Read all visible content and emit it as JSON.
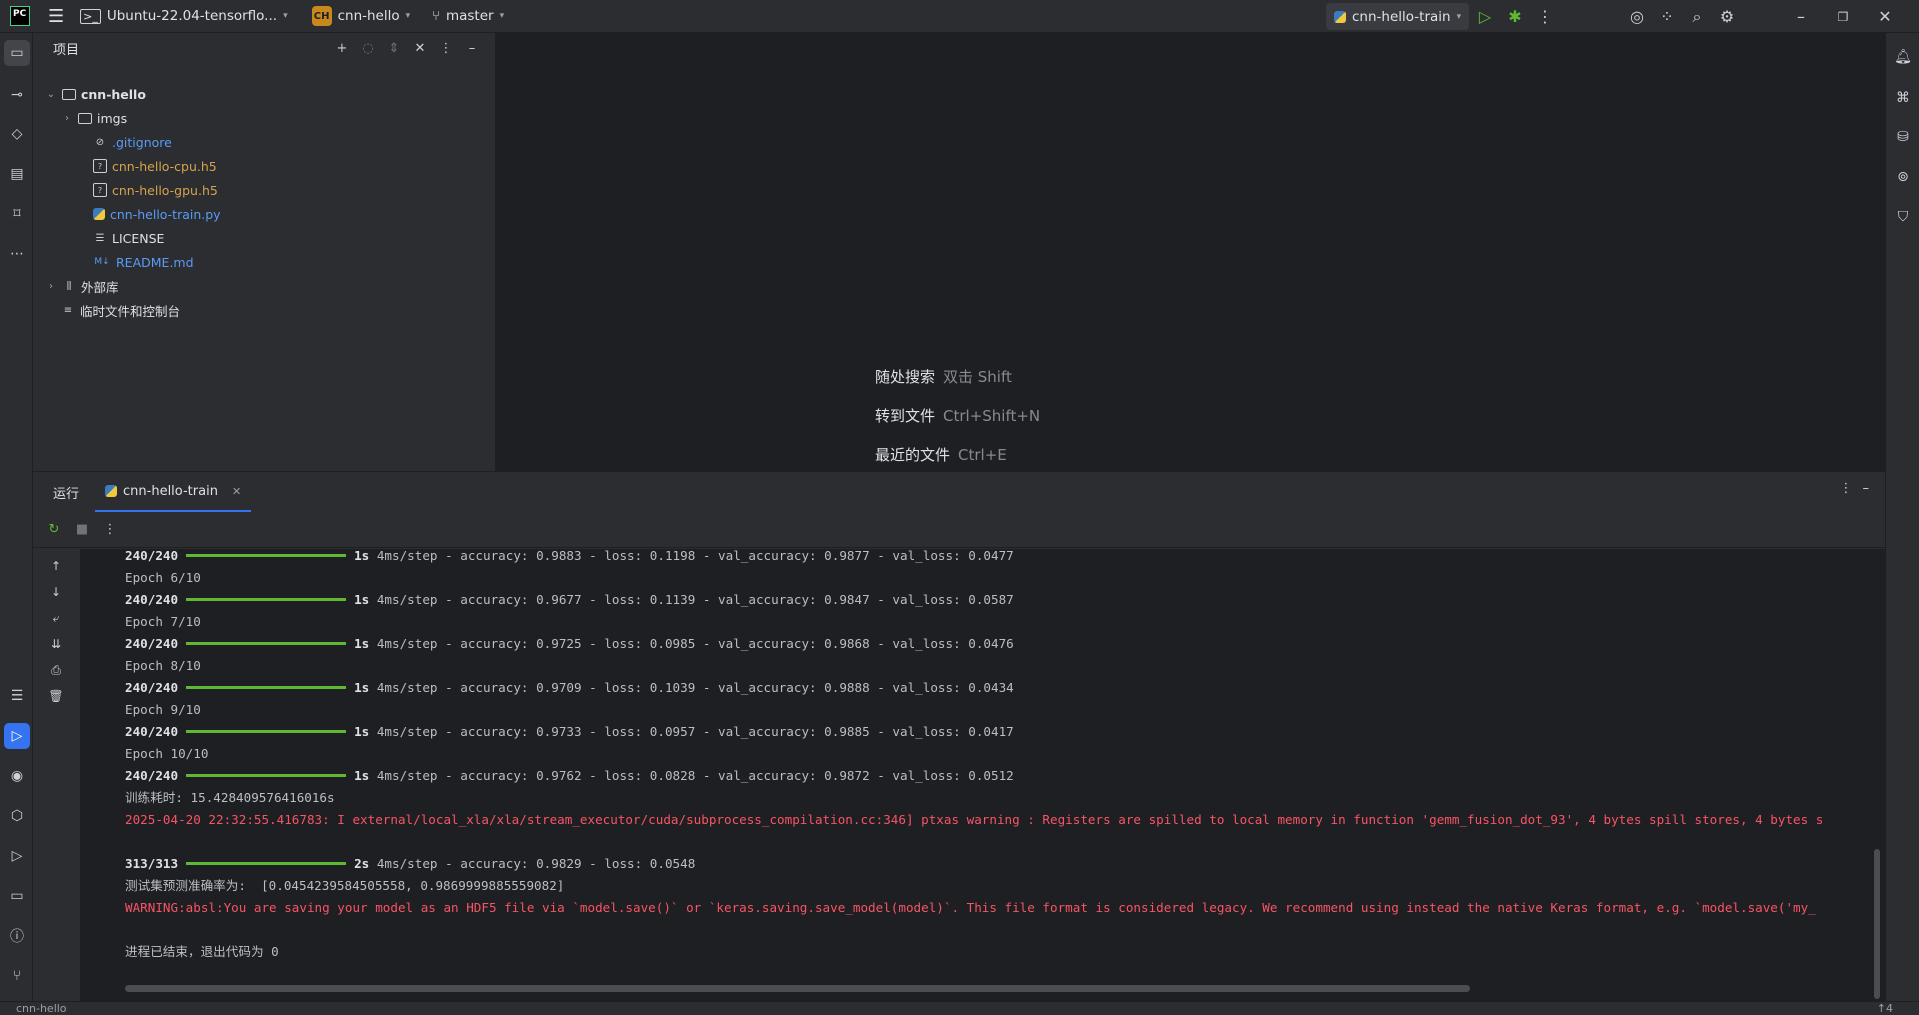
{
  "titlebar": {
    "logo_text": "PC",
    "vm_name": "Ubuntu-22.04-tensorflo...",
    "project_badge": "CH",
    "project_name": "cnn-hello",
    "branch": "master",
    "run_config": "cnn-hello-train"
  },
  "project_panel": {
    "title": "项目",
    "tree": [
      {
        "label": "cnn-hello",
        "kind": "folder-root",
        "color": "#dfe1e5"
      },
      {
        "label": "imgs",
        "kind": "folder",
        "color": "#dfe1e5"
      },
      {
        "label": ".gitignore",
        "kind": "ignore-file",
        "color": "#5a9bf5"
      },
      {
        "label": "cnn-hello-cpu.h5",
        "kind": "unknown-file",
        "color": "#d6a24c"
      },
      {
        "label": "cnn-hello-gpu.h5",
        "kind": "unknown-file",
        "color": "#d6a24c"
      },
      {
        "label": "cnn-hello-train.py",
        "kind": "python-file",
        "color": "#5a9bf5"
      },
      {
        "label": "LICENSE",
        "kind": "text-file",
        "color": "#dfe1e5"
      },
      {
        "label": "README.md",
        "kind": "markdown-file",
        "color": "#5a9bf5"
      },
      {
        "label": "外部库",
        "kind": "library",
        "color": "#dfe1e5"
      },
      {
        "label": "临时文件和控制台",
        "kind": "scratches",
        "color": "#dfe1e5"
      }
    ]
  },
  "editor_hints": [
    {
      "label": "随处搜索",
      "shortcut": "双击 Shift"
    },
    {
      "label": "转到文件",
      "shortcut": "Ctrl+Shift+N"
    },
    {
      "label": "最近的文件",
      "shortcut": "Ctrl+E"
    }
  ],
  "run_panel": {
    "tab_run": "运行",
    "tab_active": "cnn-hello-train"
  },
  "console": {
    "lines": [
      {
        "type": "progress",
        "step": "240/240",
        "time": "1s",
        "rest": "4ms/step - accuracy: 0.9883 - loss: 0.1198 - val_accuracy: 0.9877 - val_loss: 0.0477"
      },
      {
        "type": "plain",
        "text": "Epoch 6/10"
      },
      {
        "type": "progress",
        "step": "240/240",
        "time": "1s",
        "rest": "4ms/step - accuracy: 0.9677 - loss: 0.1139 - val_accuracy: 0.9847 - val_loss: 0.0587"
      },
      {
        "type": "plain",
        "text": "Epoch 7/10"
      },
      {
        "type": "progress",
        "step": "240/240",
        "time": "1s",
        "rest": "4ms/step - accuracy: 0.9725 - loss: 0.0985 - val_accuracy: 0.9868 - val_loss: 0.0476"
      },
      {
        "type": "plain",
        "text": "Epoch 8/10"
      },
      {
        "type": "progress",
        "step": "240/240",
        "time": "1s",
        "rest": "4ms/step - accuracy: 0.9709 - loss: 0.1039 - val_accuracy: 0.9888 - val_loss: 0.0434"
      },
      {
        "type": "plain",
        "text": "Epoch 9/10"
      },
      {
        "type": "progress",
        "step": "240/240",
        "time": "1s",
        "rest": "4ms/step - accuracy: 0.9733 - loss: 0.0957 - val_accuracy: 0.9885 - val_loss: 0.0417"
      },
      {
        "type": "plain",
        "text": "Epoch 10/10"
      },
      {
        "type": "progress",
        "step": "240/240",
        "time": "1s",
        "rest": "4ms/step - accuracy: 0.9762 - loss: 0.0828 - val_accuracy: 0.9872 - val_loss: 0.0512"
      },
      {
        "type": "plain",
        "text": "训练耗时: 15.428409576416016s"
      },
      {
        "type": "error",
        "text": "2025-04-20 22:32:55.416783: I external/local_xla/xla/stream_executor/cuda/subprocess_compilation.cc:346] ptxas warning : Registers are spilled to local memory in function 'gemm_fusion_dot_93', 4 bytes spill stores, 4 bytes s"
      },
      {
        "type": "blank",
        "text": ""
      },
      {
        "type": "progress",
        "step": "313/313",
        "time": "2s",
        "rest": "4ms/step - accuracy: 0.9829 - loss: 0.0548"
      },
      {
        "type": "plain",
        "text": "测试集预测准确率为:  [0.0454239584505558, 0.9869999885559082]"
      },
      {
        "type": "error",
        "text": "WARNING:absl:You are saving your model as an HDF5 file via `model.save()` or `keras.saving.save_model(model)`. This file format is considered legacy. We recommend using instead the native Keras format, e.g. `model.save('my_"
      },
      {
        "type": "blank",
        "text": ""
      },
      {
        "type": "plain",
        "text": "进程已结束，退出代码为 0"
      }
    ]
  },
  "statusbar": {
    "project": "cnn-hello",
    "right": "↑4"
  }
}
